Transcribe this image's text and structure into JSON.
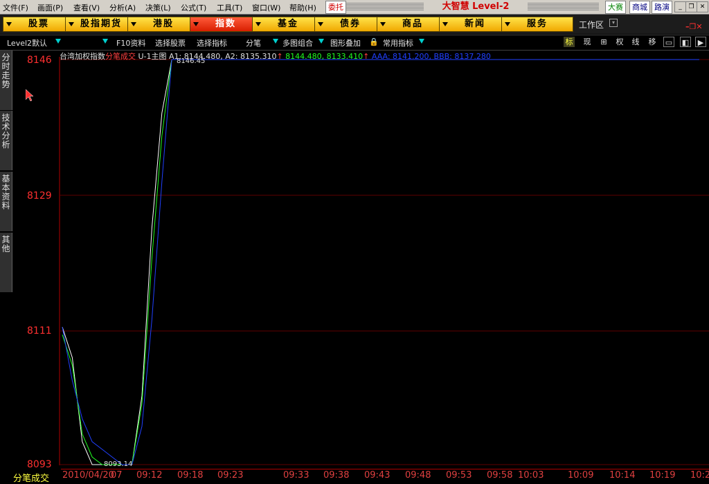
{
  "menu": [
    "文件(F)",
    "画面(P)",
    "查看(V)",
    "分析(A)",
    "决策(L)",
    "公式(T)",
    "工具(T)",
    "窗口(W)",
    "帮助(H)"
  ],
  "trade_button": "委托",
  "logo": "大智慧 Level-2",
  "right_buttons": [
    "大赛",
    "商城",
    "路演"
  ],
  "nav": [
    "股票",
    "股指期货",
    "港股",
    "指数",
    "基金",
    "债券",
    "商品",
    "新闻",
    "服务"
  ],
  "active_nav": "指数",
  "workspace": "工作区",
  "toolbar": {
    "level2": "Level2默认",
    "f10": "F10资料",
    "select_stock": "选择股票",
    "select_indicator": "选择指标",
    "fenbi": "分笔",
    "multi": "多图组合",
    "overlay": "图形叠加",
    "common": "常用指标",
    "right_icons": [
      "标",
      "现",
      "⊞",
      "权",
      "线",
      "移"
    ]
  },
  "side_tabs": [
    "分时走势",
    "技术分析",
    "基本资料",
    "其他"
  ],
  "chart_header": {
    "name": "台湾加权指数",
    "mode": "分笔成交",
    "main": "U-1主图",
    "a1": "A1: 8144.480, A2: 8135.310",
    "green": "8144.480, 8133.410",
    "blue": "AAA: 8141.200, BBB: 8137.280"
  },
  "status_label": "分笔成交",
  "chart_data": {
    "type": "line",
    "y_ticks": [
      "8146",
      "8129",
      "8111",
      "8093"
    ],
    "ylim": [
      8093,
      8146
    ],
    "x_ticks": [
      "2010/04/20",
      "07",
      "09:12",
      "09:18",
      "09:23",
      "09:33",
      "09:38",
      "09:43",
      "09:48",
      "09:53",
      "09:58",
      "10:03",
      "10:09",
      "10:14",
      "10:19",
      "10:2"
    ],
    "annotations": [
      "8146.45",
      "8093.14"
    ],
    "series": [
      {
        "name": "A1",
        "color": "#ffffff",
        "values": [
          8111,
          8107,
          8096,
          8093,
          8093,
          8093,
          8093,
          8093,
          8102,
          8124,
          8139,
          8146,
          8146,
          8146,
          8146,
          8146,
          8146,
          8146,
          8146,
          8146,
          8146,
          8146,
          8146,
          8146,
          8146,
          8146,
          8146,
          8146,
          8146,
          8146,
          8146,
          8146,
          8146,
          8146,
          8146,
          8146,
          8146,
          8146,
          8146,
          8146,
          8146,
          8146,
          8146,
          8146,
          8146,
          8146,
          8146,
          8146,
          8146,
          8146,
          8146,
          8146,
          8146,
          8146,
          8146,
          8146,
          8146,
          8146,
          8146,
          8146,
          8146,
          8146,
          8146,
          8146,
          8146
        ]
      },
      {
        "name": "A2",
        "color": "#20ff20",
        "values": [
          8110,
          8106,
          8097,
          8094,
          8093,
          8093,
          8093,
          8093,
          8101,
          8120,
          8136,
          8146,
          8146,
          8146,
          8146,
          8146,
          8146,
          8146,
          8146,
          8146,
          8146,
          8146,
          8146,
          8146,
          8146,
          8146,
          8146,
          8146,
          8146,
          8146,
          8146,
          8146,
          8146,
          8146,
          8146,
          8146,
          8146,
          8146,
          8146,
          8146,
          8146,
          8146,
          8146,
          8146,
          8146,
          8146,
          8146,
          8146,
          8146,
          8146,
          8146,
          8146,
          8146,
          8146,
          8146,
          8146,
          8146,
          8146,
          8146,
          8146,
          8146,
          8146,
          8146,
          8146,
          8146
        ]
      },
      {
        "name": "AAA",
        "color": "#2040ff",
        "values": [
          8111,
          8104,
          8099,
          8096,
          8095,
          8094,
          8093,
          8093,
          8098,
          8112,
          8130,
          8146,
          8146,
          8146,
          8146,
          8146,
          8146,
          8146,
          8146,
          8146,
          8146,
          8146,
          8146,
          8146,
          8146,
          8146,
          8146,
          8146,
          8146,
          8146,
          8146,
          8146,
          8146,
          8146,
          8146,
          8146,
          8146,
          8146,
          8146,
          8146,
          8146,
          8146,
          8146,
          8146,
          8146,
          8146,
          8146,
          8146,
          8146,
          8146,
          8146,
          8146,
          8146,
          8146,
          8146,
          8146,
          8146,
          8146,
          8146,
          8146,
          8146,
          8146,
          8146,
          8146,
          8146
        ]
      }
    ]
  }
}
